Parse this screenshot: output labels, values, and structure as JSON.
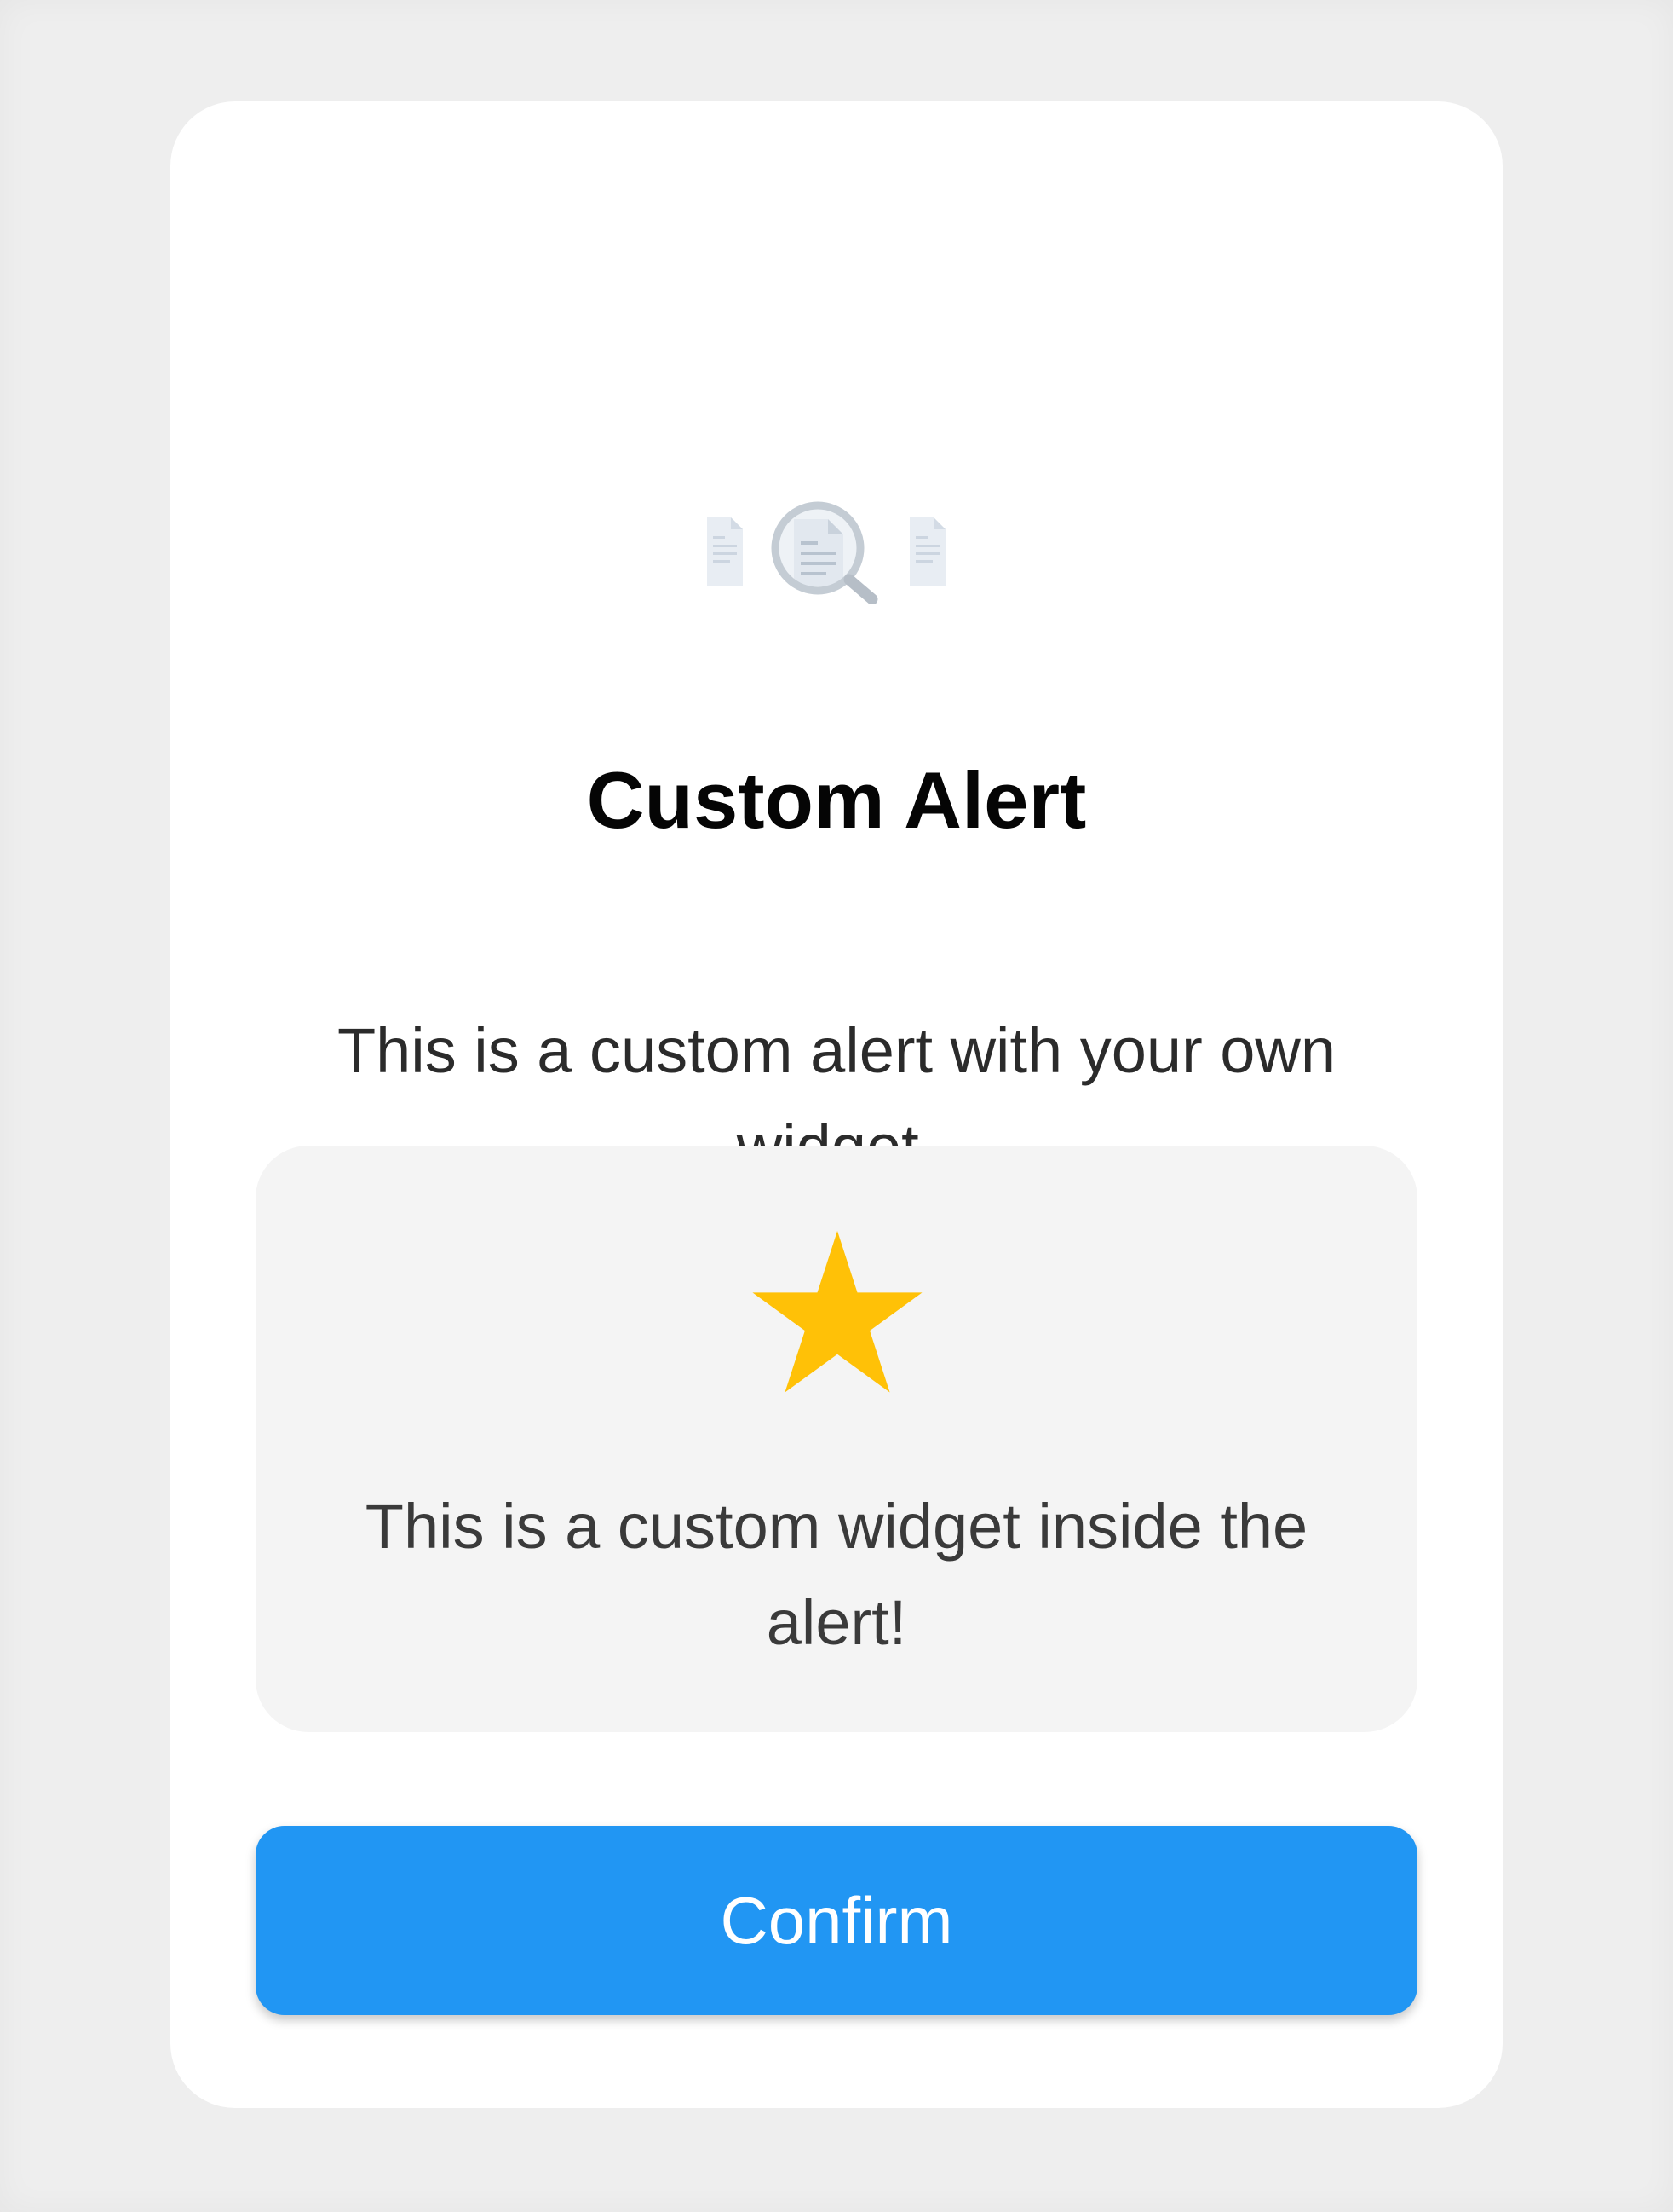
{
  "colors": {
    "backdrop": "#eeeeee",
    "dialog": "#ffffff",
    "widget_background": "#f4f4f4",
    "star": "#ffc107",
    "button": "#2196f3",
    "button_text": "#ffffff"
  },
  "dialog": {
    "illustration": [
      "document-icon",
      "magnifier-document-icon",
      "document-icon"
    ],
    "title": "Custom Alert",
    "message": "This is a custom alert with your own widget.",
    "custom_widget": {
      "icon": "star-icon",
      "text": "This is a custom widget inside the alert!"
    },
    "confirm_label": "Confirm"
  }
}
